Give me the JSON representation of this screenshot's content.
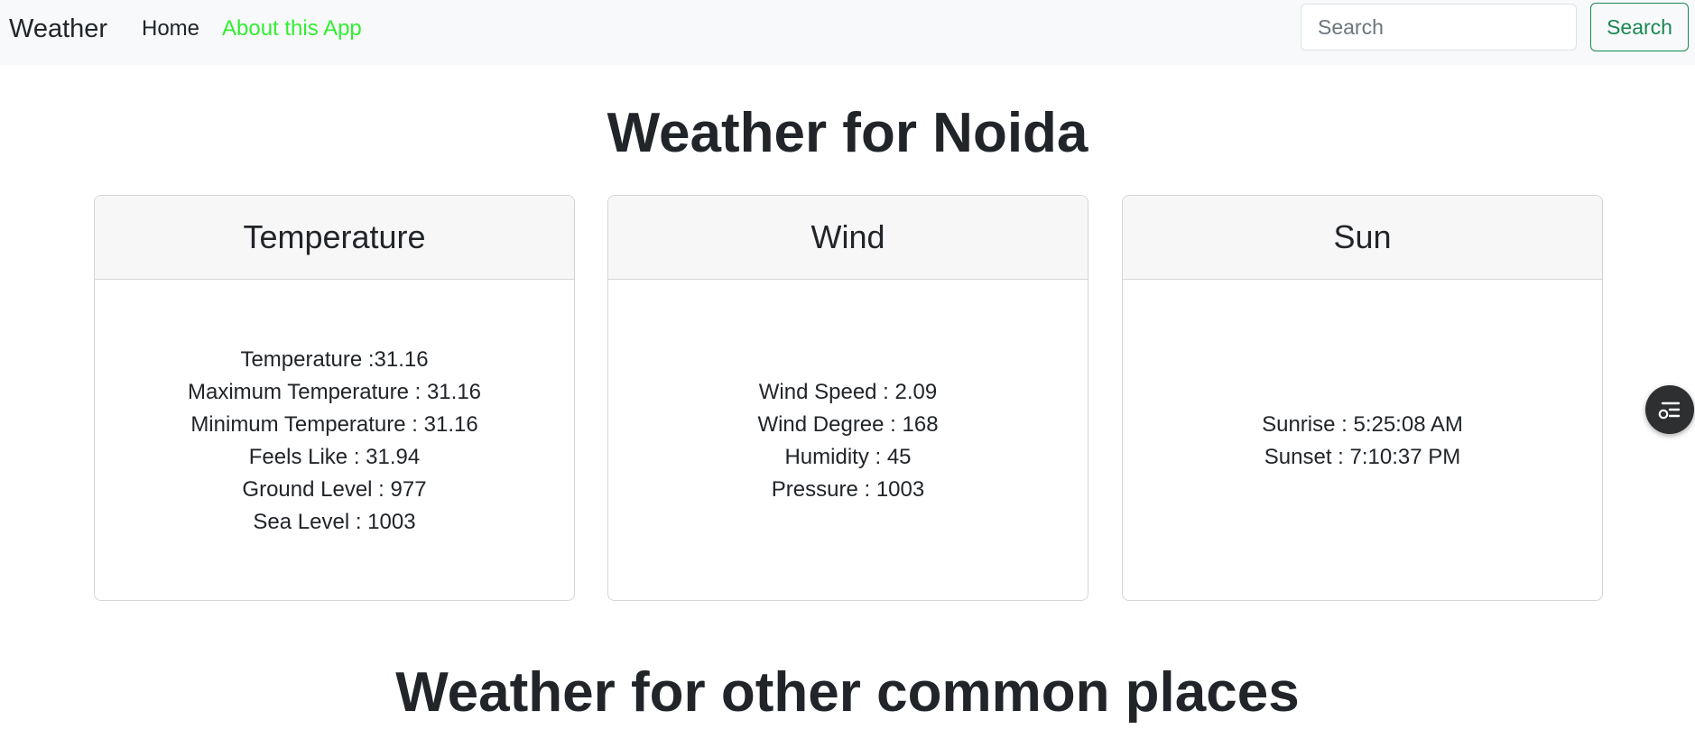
{
  "navbar": {
    "brand": "Weather",
    "links": [
      {
        "label": "Home"
      },
      {
        "label": "About this App"
      }
    ],
    "search": {
      "placeholder": "Search",
      "value": "",
      "button_label": "Search"
    }
  },
  "page_title": "Weather for Noida",
  "cards": [
    {
      "title": "Temperature",
      "lines": [
        "Temperature :31.16",
        "Maximum Temperature : 31.16",
        "Minimum Temperature : 31.16",
        "Feels Like : 31.94",
        "Ground Level : 977",
        "Sea Level : 1003"
      ]
    },
    {
      "title": "Wind",
      "lines": [
        "Wind Speed : 2.09",
        "Wind Degree : 168",
        "Humidity : 45",
        "Pressure : 1003"
      ]
    },
    {
      "title": "Sun",
      "lines": [
        "Sunrise : 5:25:08 AM",
        "Sunset : 7:10:37 PM"
      ]
    }
  ],
  "floating_button": {
    "icon": "sidebar-list-icon"
  },
  "bottom_heading": "Weather for other common places",
  "colors": {
    "navbar_bg": "#f8f9fa",
    "about_link": "#33ee33",
    "search_button": "#198754",
    "card_header_bg": "#f7f7f7"
  }
}
